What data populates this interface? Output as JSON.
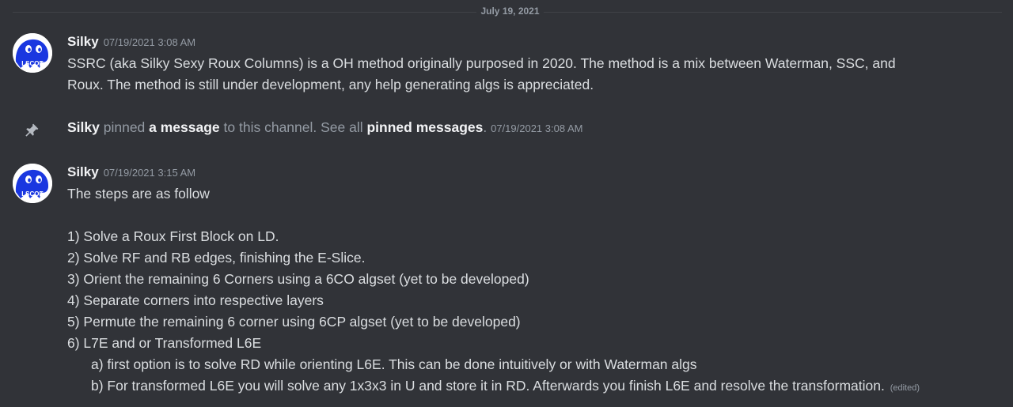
{
  "date_divider": "July 19, 2021",
  "messages": [
    {
      "author": "Silky",
      "timestamp": "07/19/2021 3:08 AM",
      "lines": [
        "SSRC (aka Silky Sexy Roux Columns) is a OH method originally purposed in 2020. The method is a mix between Waterman, SSC, and",
        "Roux. The method is still under development, any help generating algs is appreciated."
      ]
    },
    {
      "author": "Silky",
      "timestamp": "07/19/2021 3:15 AM",
      "lines": [
        "The steps are as follow",
        "1) Solve a Roux First Block on LD.",
        "2) Solve RF and RB edges, finishing the E-Slice.",
        "3) Orient the remaining 6 Corners using a 6CO algset (yet to be developed)",
        "4) Separate corners into respective layers",
        "5) Permute the remaining 6 corner using 6CP algset (yet to be developed)",
        "6) L7E and or Transformed L6E",
        "a) first option is to solve RD while orienting L6E. This can be done intuitively or with Waterman algs",
        "b) For transformed L6E you will solve any 1x3x3 in U and store it in RD. Afterwards you finish L6E and resolve the transformation."
      ],
      "edited_label": "(edited)"
    }
  ],
  "system_pin": {
    "user": "Silky",
    "text_1": " pinned ",
    "link_1": "a message",
    "text_2": " to this channel. See all ",
    "link_2": "pinned messages",
    "text_3": ". ",
    "timestamp": "07/19/2021 3:08 AM",
    "icon": "pin-icon"
  },
  "avatar": {
    "icon": "avatar-blob-icon",
    "caption": "LSCOE"
  },
  "colors": {
    "background": "#313338",
    "text": "#dbdee1",
    "muted": "#949ba4",
    "username": "#f2f3f5",
    "avatar_blue": "#1a37e0"
  }
}
